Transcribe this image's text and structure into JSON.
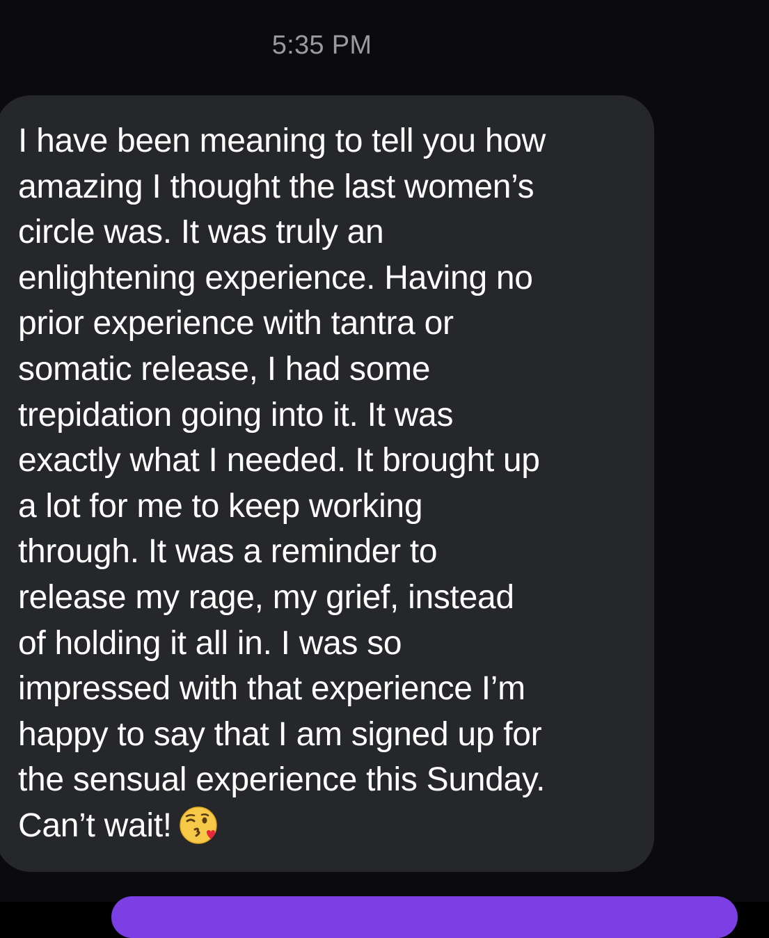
{
  "thread": {
    "timestamp": "5:35 PM"
  },
  "message": {
    "text": "I have been meaning to tell you how\namazing I thought the last women’s\ncircle was. It was truly an\nenlightening experience. Having no\nprior experience with tantra or\nsomatic release, I had some\ntrepidation going into it. It was\nexactly what I needed. It brought up\na lot for me to keep working\nthrough. It was a reminder to\nrelease my rage, my grief, instead\nof holding it all in. I was so\nimpressed with that experience I’m\nhappy to say that I am signed up for\nthe sensual experience this Sunday.\nCan’t wait!",
    "emoji": "face-blowing-kiss-icon"
  },
  "colors": {
    "background": "#0b0b0d",
    "incoming_bubble": "#26272b",
    "outgoing_bubble": "#7b3fe4",
    "timestamp_text": "#9a9aa1",
    "message_text": "#ffffff"
  }
}
